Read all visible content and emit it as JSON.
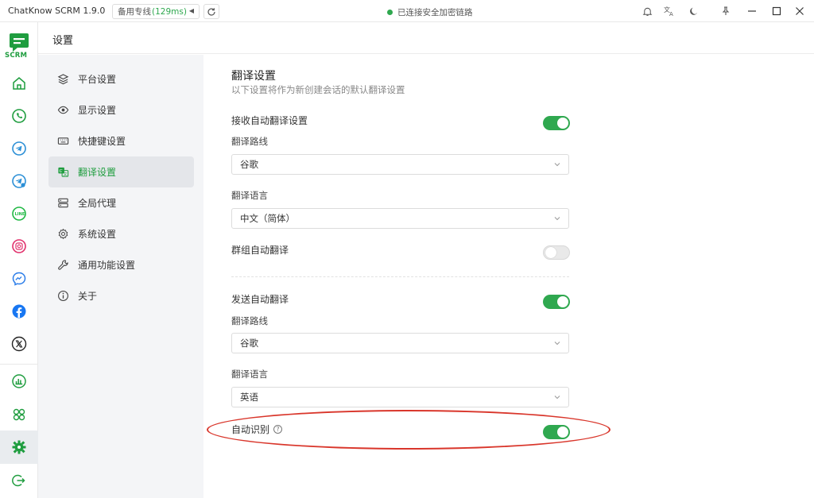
{
  "window": {
    "title": "ChatKnow SCRM 1.9.0",
    "line_select": {
      "label": "备用专线",
      "ping": "(129ms)"
    },
    "status_text": "已连接安全加密链路"
  },
  "rail": {
    "logo_text": "SCRM",
    "items": [
      "home",
      "whatsapp",
      "telegram",
      "telegram-business",
      "line",
      "instagram",
      "messenger",
      "facebook",
      "x"
    ],
    "bottom_items": [
      "statistics",
      "apps",
      "settings",
      "logout"
    ],
    "active": "settings"
  },
  "page": {
    "title": "设置"
  },
  "menu": {
    "items": [
      {
        "id": "platform",
        "label": "平台设置",
        "icon": "layers-icon"
      },
      {
        "id": "display",
        "label": "显示设置",
        "icon": "eye-icon"
      },
      {
        "id": "shortcut",
        "label": "快捷键设置",
        "icon": "keyboard-icon"
      },
      {
        "id": "translate",
        "label": "翻译设置",
        "icon": "translate-icon",
        "active": true
      },
      {
        "id": "proxy",
        "label": "全局代理",
        "icon": "server-icon"
      },
      {
        "id": "system",
        "label": "系统设置",
        "icon": "gear-icon"
      },
      {
        "id": "general",
        "label": "通用功能设置",
        "icon": "wrench-icon"
      },
      {
        "id": "about",
        "label": "关于",
        "icon": "info-icon"
      }
    ]
  },
  "translate": {
    "title": "翻译设置",
    "subtitle": "以下设置将作为新创建会话的默认翻译设置",
    "receive": {
      "label": "接收自动翻译设置",
      "enabled": true,
      "route_label": "翻译路线",
      "route_value": "谷歌",
      "lang_label": "翻译语言",
      "lang_value": "中文（简体）"
    },
    "group": {
      "label": "群组自动翻译",
      "enabled": false
    },
    "send": {
      "label": "发送自动翻译",
      "enabled": true,
      "route_label": "翻译路线",
      "route_value": "谷歌",
      "lang_label": "翻译语言",
      "lang_value": "英语"
    },
    "auto_detect": {
      "label": "自动识别",
      "help": "?",
      "enabled": true
    }
  },
  "colors": {
    "accent": "#2fa84f",
    "annotation": "#d9362b"
  }
}
